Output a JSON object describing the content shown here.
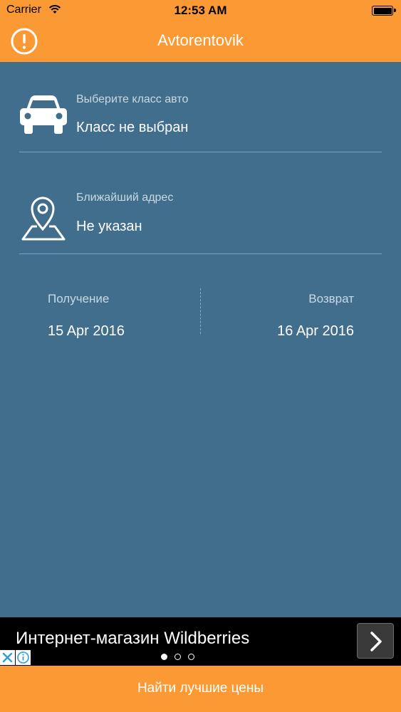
{
  "status_bar": {
    "carrier": "Carrier",
    "time": "12:53 AM",
    "wifi_icon": "wifi-icon",
    "battery_icon": "battery-icon"
  },
  "nav": {
    "title": "Avtorentovik",
    "alert_icon": "alert-circle-icon"
  },
  "car_class": {
    "icon": "car-icon",
    "label": "Выберите класс авто",
    "value": "Класс не выбран"
  },
  "address": {
    "icon": "location-pin-icon",
    "label": "Ближайший адрес",
    "value": "Не указан"
  },
  "dates": {
    "pickup_label": "Получение",
    "pickup_value": "15 Apr 2016",
    "return_label": "Возврат",
    "return_value": "16 Apr 2016"
  },
  "ad": {
    "text": "Интернет-магазин Wildberries",
    "arrow_icon": "chevron-right-icon",
    "pages": 3,
    "active_page": 1
  },
  "bottom_button": {
    "label": "Найти лучшие цены"
  },
  "colors": {
    "accent": "#fb9a35",
    "background": "#416e8c",
    "divider": "#7fa2ba",
    "label": "#c9d9e4"
  }
}
